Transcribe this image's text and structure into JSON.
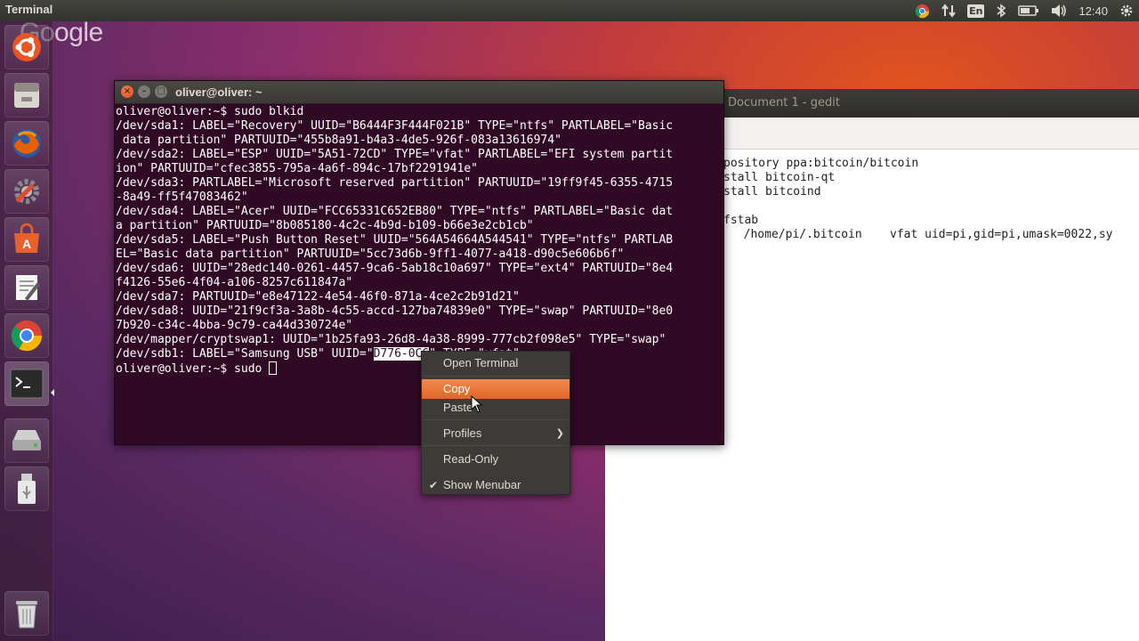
{
  "top_panel": {
    "app_title": "Terminal",
    "keyboard_layout": "En",
    "clock": "12:40",
    "tray_icons": [
      "chrome-icon",
      "network-arrows-icon",
      "keyboard-icon",
      "bluetooth-icon",
      "battery-icon",
      "volume-icon",
      "gear-icon"
    ]
  },
  "watermark": "Google",
  "launcher": {
    "items": [
      "ubuntu-dash-icon",
      "files-icon",
      "firefox-icon",
      "system-settings-icon",
      "software-center-icon",
      "text-editor-icon",
      "chrome-icon",
      "terminal-icon",
      "disk-drive-icon",
      "usb-drive-icon",
      "trash-icon"
    ]
  },
  "gedit": {
    "title": "Document 1 - gedit",
    "lines": [
      "pository ppa:bitcoin/bitcoin",
      "stall bitcoin-qt",
      "stall bitcoind",
      "",
      "fstab",
      "  /home/pi/.bitcoin    vfat uid=pi,gid=pi,umask=0022,sy"
    ]
  },
  "terminal": {
    "title": "oliver@oliver: ~",
    "lines": [
      "oliver@oliver:~$ sudo blkid",
      "/dev/sda1: LABEL=\"Recovery\" UUID=\"B6444F3F444F021B\" TYPE=\"ntfs\" PARTLABEL=\"Basic",
      " data partition\" PARTUUID=\"455b8a91-b4a3-4de5-926f-083a13616974\"",
      "/dev/sda2: LABEL=\"ESP\" UUID=\"5A51-72CD\" TYPE=\"vfat\" PARTLABEL=\"EFI system partit",
      "ion\" PARTUUID=\"cfec3855-795a-4a6f-894c-17bf2291941e\"",
      "/dev/sda3: PARTLABEL=\"Microsoft reserved partition\" PARTUUID=\"19ff9f45-6355-4715",
      "-8a49-ff5f47083462\"",
      "/dev/sda4: LABEL=\"Acer\" UUID=\"FCC65331C652EB80\" TYPE=\"ntfs\" PARTLABEL=\"Basic dat",
      "a partition\" PARTUUID=\"8b085180-4c2c-4b9d-b109-b66e3e2cb1cb\"",
      "/dev/sda5: LABEL=\"Push Button Reset\" UUID=\"564A54664A544541\" TYPE=\"ntfs\" PARTLAB",
      "EL=\"Basic data partition\" PARTUUID=\"5cc73d6b-9ff1-4077-a418-d90c5e606b6f\"",
      "/dev/sda6: UUID=\"28edc140-0261-4457-9ca6-5ab18c10a697\" TYPE=\"ext4\" PARTUUID=\"8e4",
      "f4126-55e6-4f04-a106-8257c611847a\"",
      "/dev/sda7: PARTUUID=\"e8e47122-4e54-46f0-871a-4ce2c2b91d21\"",
      "/dev/sda8: UUID=\"21f9cf3a-3a8b-4c55-accd-127ba74839e0\" TYPE=\"swap\" PARTUUID=\"8e0",
      "7b920-c34c-4bba-9c79-ca44d330724e\"",
      "/dev/mapper/cryptswap1: UUID=\"1b25fa93-26d8-4a38-8999-777cb2f098e5\" TYPE=\"swap\""
    ],
    "sdb1_line_prefix": "/dev/sdb1: LABEL=\"Samsung USB\" UUID=\"",
    "sdb1_selected": "D776-0C6",
    "sdb1_line_suffix": "\" TYPE=\"vfat\"",
    "prompt_line": "oliver@oliver:~$ sudo "
  },
  "context_menu": {
    "items": [
      {
        "label": "Open Terminal"
      },
      {
        "label": "Copy",
        "active": true
      },
      {
        "label": "Paste"
      },
      {
        "label": "Profiles",
        "submenu": true
      },
      {
        "label": "Read-Only"
      },
      {
        "label": "Show Menubar",
        "checked": true
      }
    ],
    "check_glyph": "✔",
    "submenu_glyph": "❯"
  }
}
